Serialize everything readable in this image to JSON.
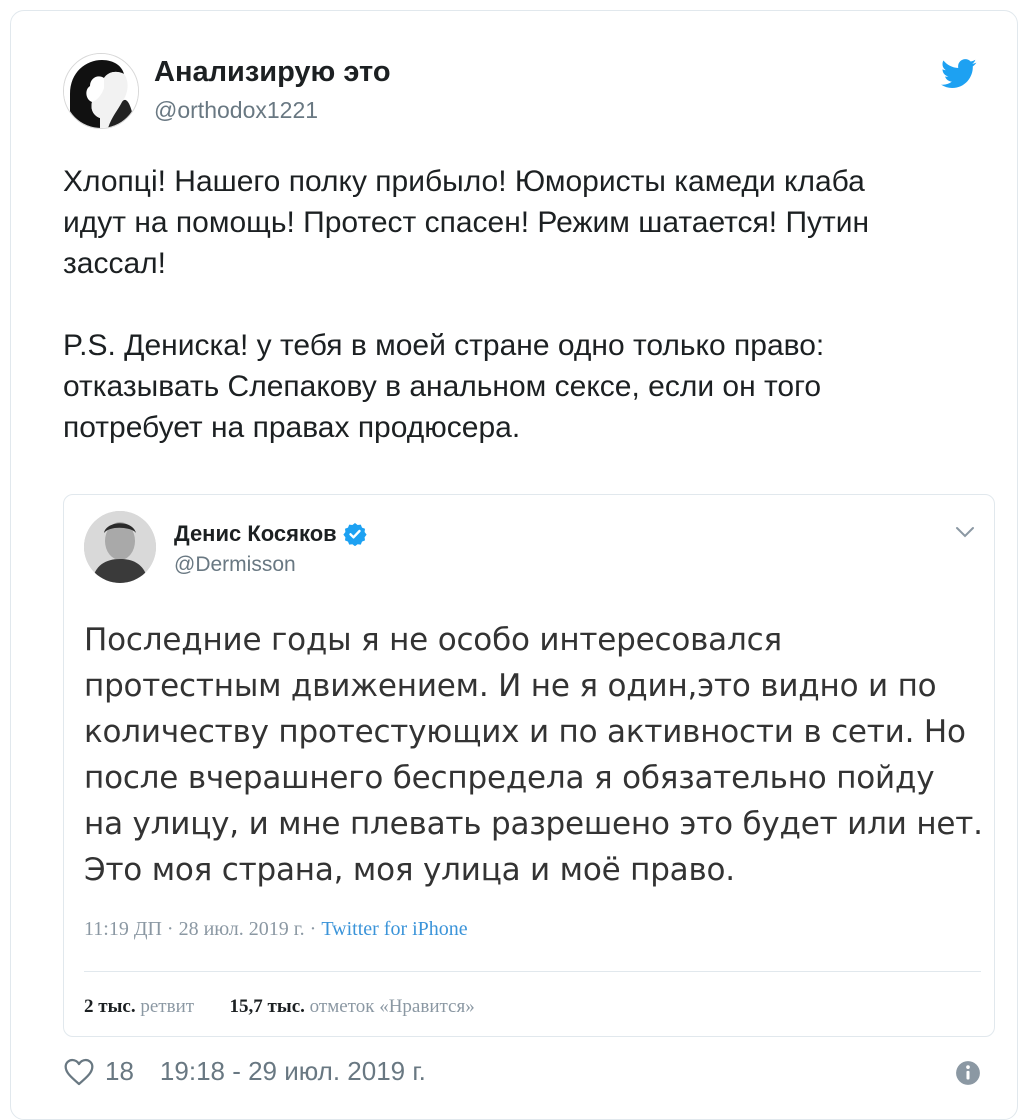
{
  "tweet": {
    "author_name": "Анализирую это",
    "author_handle": "@orthodox1221",
    "paragraphs": [
      "Хлопцi! Нашего полку прибыло! Юмористы камеди клаба\nидут на помощь! Протест спасен! Режим шатается! Путин\nзассал!",
      "P.S. Дениска! у тебя в моей стране одно только право:\nотказывать Слепакову в анальном сексе, если он того\nпотребует на правах продюсера."
    ],
    "likes": "18",
    "timestamp": "19:18 - 29 июл. 2019 г."
  },
  "quoted": {
    "author_name": "Денис Косяков",
    "author_handle": "@Dermisson",
    "text": "Последние годы я не особо интересовался\nпротестным движением. И не я один,это видно и по\nколичеству протестующих  и по активности в сети. Но\nпосле вчерашнего беспредела я обязательно пойду\nна улицу, и мне плевать разрешено это будет или нет.\nЭто моя страна, моя улица и моё право.",
    "time": "11:19 ДП",
    "date": "28 июл. 2019 г.",
    "separator": "·",
    "source": "Twitter for iPhone",
    "retweets_count": "2 тыс.",
    "retweets_label": "ретвит",
    "likes_count": "15,7 тыс.",
    "likes_label": "отметок «Нравится»"
  },
  "icons": {
    "brand": "twitter-bird-icon",
    "verified": "verified-badge-icon",
    "menu": "chevron-down-icon",
    "like": "heart-icon",
    "info": "info-icon"
  },
  "colors": {
    "twitter_blue": "#1da1f2",
    "link_blue": "#3b94d9",
    "muted_text": "#697882",
    "border": "#e1e8ed"
  }
}
